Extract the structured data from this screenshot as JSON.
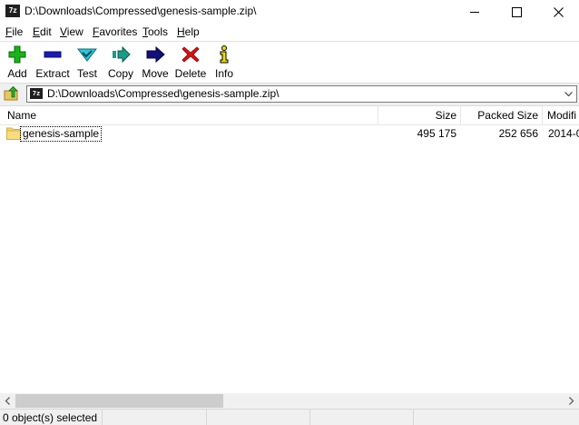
{
  "window": {
    "app_icon_text": "7z",
    "title": "D:\\Downloads\\Compressed\\genesis-sample.zip\\"
  },
  "menu": {
    "items": [
      {
        "ul": "F",
        "rest": "ile"
      },
      {
        "ul": "E",
        "rest": "dit"
      },
      {
        "ul": "V",
        "rest": "iew"
      },
      {
        "ul": "F",
        "rest": "avorites"
      },
      {
        "ul": "T",
        "rest": "ools"
      },
      {
        "ul": "H",
        "rest": "elp"
      }
    ]
  },
  "toolbar": {
    "buttons": [
      {
        "label": "Add",
        "icon": "plus-icon",
        "color": "#18b418"
      },
      {
        "label": "Extract",
        "icon": "minus-icon",
        "color": "#1a1ab8"
      },
      {
        "label": "Test",
        "icon": "check-down-icon",
        "color": "#2dc8d8"
      },
      {
        "label": "Copy",
        "icon": "copy-arrow-icon",
        "color": "#1a9a8a"
      },
      {
        "label": "Move",
        "icon": "move-arrow-icon",
        "color": "#10107a"
      },
      {
        "label": "Delete",
        "icon": "delete-x-icon",
        "color": "#e01010"
      },
      {
        "label": "Info",
        "icon": "info-icon",
        "color": "#e8e000"
      }
    ]
  },
  "address": {
    "path": "D:\\Downloads\\Compressed\\genesis-sample.zip\\",
    "zip_icon_text": "7z"
  },
  "list": {
    "columns": {
      "name": "Name",
      "size": "Size",
      "packed": "Packed Size",
      "modified": "Modifi"
    },
    "rows": [
      {
        "name": "genesis-sample",
        "size": "495 175",
        "packed": "252 656",
        "modified": "2014-0"
      }
    ]
  },
  "status": {
    "selected": "0 object(s) selected"
  }
}
